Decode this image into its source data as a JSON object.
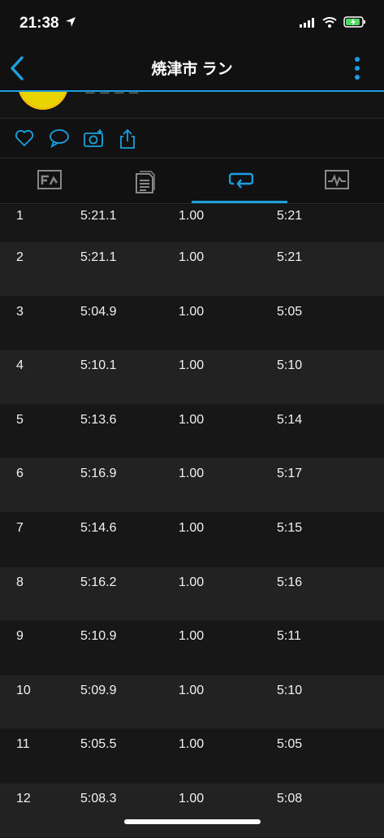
{
  "status_bar": {
    "time": "21:38"
  },
  "navbar": {
    "title": "焼津市 ラン"
  },
  "header_glimpse": {
    "text": "ー ー ー ー"
  },
  "colors": {
    "accent": "#1aa0e0",
    "background": "#111112",
    "row_odd": "#171717",
    "row_even": "#222222"
  },
  "actions": [
    {
      "icon": "heart-icon"
    },
    {
      "icon": "comment-icon"
    },
    {
      "icon": "add-photo-icon"
    },
    {
      "icon": "share-icon"
    }
  ],
  "tabs": [
    {
      "icon": "map-icon",
      "active": false
    },
    {
      "icon": "details-icon",
      "active": false
    },
    {
      "icon": "laps-icon",
      "active": true
    },
    {
      "icon": "graph-icon",
      "active": false
    }
  ],
  "laps": [
    {
      "lap": "1",
      "time": "5:21.1",
      "distance": "1.00",
      "pace": "5:21"
    },
    {
      "lap": "2",
      "time": "5:21.1",
      "distance": "1.00",
      "pace": "5:21"
    },
    {
      "lap": "3",
      "time": "5:04.9",
      "distance": "1.00",
      "pace": "5:05"
    },
    {
      "lap": "4",
      "time": "5:10.1",
      "distance": "1.00",
      "pace": "5:10"
    },
    {
      "lap": "5",
      "time": "5:13.6",
      "distance": "1.00",
      "pace": "5:14"
    },
    {
      "lap": "6",
      "time": "5:16.9",
      "distance": "1.00",
      "pace": "5:17"
    },
    {
      "lap": "7",
      "time": "5:14.6",
      "distance": "1.00",
      "pace": "5:15"
    },
    {
      "lap": "8",
      "time": "5:16.2",
      "distance": "1.00",
      "pace": "5:16"
    },
    {
      "lap": "9",
      "time": "5:10.9",
      "distance": "1.00",
      "pace": "5:11"
    },
    {
      "lap": "10",
      "time": "5:09.9",
      "distance": "1.00",
      "pace": "5:10"
    },
    {
      "lap": "11",
      "time": "5:05.5",
      "distance": "1.00",
      "pace": "5:05"
    },
    {
      "lap": "12",
      "time": "5:08.3",
      "distance": "1.00",
      "pace": "5:08"
    }
  ]
}
